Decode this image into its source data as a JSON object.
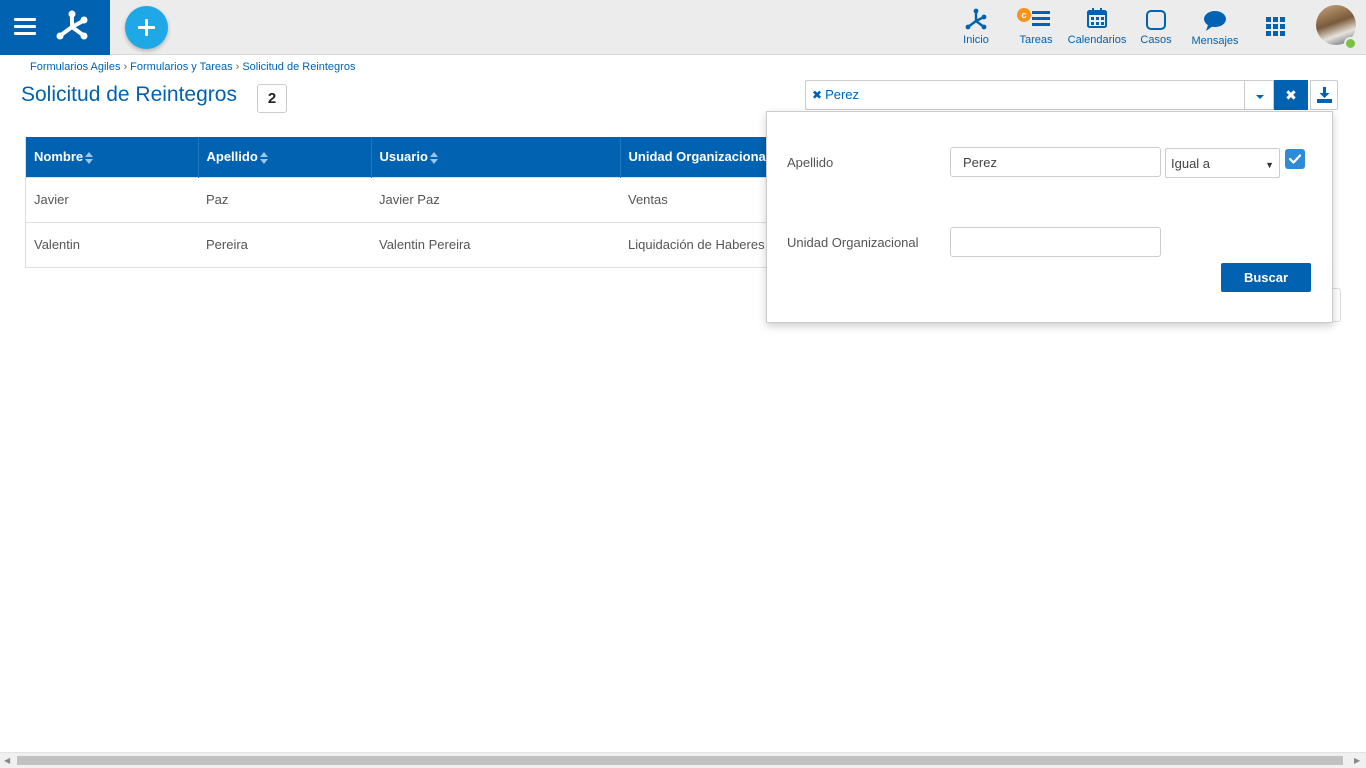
{
  "topbar": {
    "nav": [
      {
        "label": "Inicio",
        "icon": "process-icon"
      },
      {
        "label": "Tareas",
        "icon": "tasks-icon",
        "badge": "c"
      },
      {
        "label": "Calendarios",
        "icon": "calendar-icon"
      },
      {
        "label": "Casos",
        "icon": "cases-icon"
      },
      {
        "label": "Mensajes",
        "icon": "message-icon"
      }
    ],
    "apps_icon": "apps-grid-icon",
    "brand_color": "#0062b0",
    "add_color": "#1ea9e6",
    "online_color": "#7dc142"
  },
  "breadcrumb": [
    "Formularios Agiles",
    "Formularios y Tareas",
    "Solicitud de Reintegros"
  ],
  "page": {
    "title": "Solicitud de Reintegros",
    "count": "2"
  },
  "filter": {
    "chip": "Perez"
  },
  "grid": {
    "columns": [
      "Nombre",
      "Apellido",
      "Usuario",
      "Unidad Organizacional"
    ],
    "rows": [
      [
        "Javier",
        "Paz",
        "Javier Paz",
        "Ventas"
      ],
      [
        "Valentin",
        "Pereira",
        "Valentin Pereira",
        "Liquidación de Haberes"
      ]
    ]
  },
  "panel": {
    "apellido_label": "Apellido",
    "apellido_value": "Perez",
    "operator": "Igual a",
    "unidad_label": "Unidad Organizacional",
    "unidad_value": "",
    "search_button": "Buscar"
  }
}
